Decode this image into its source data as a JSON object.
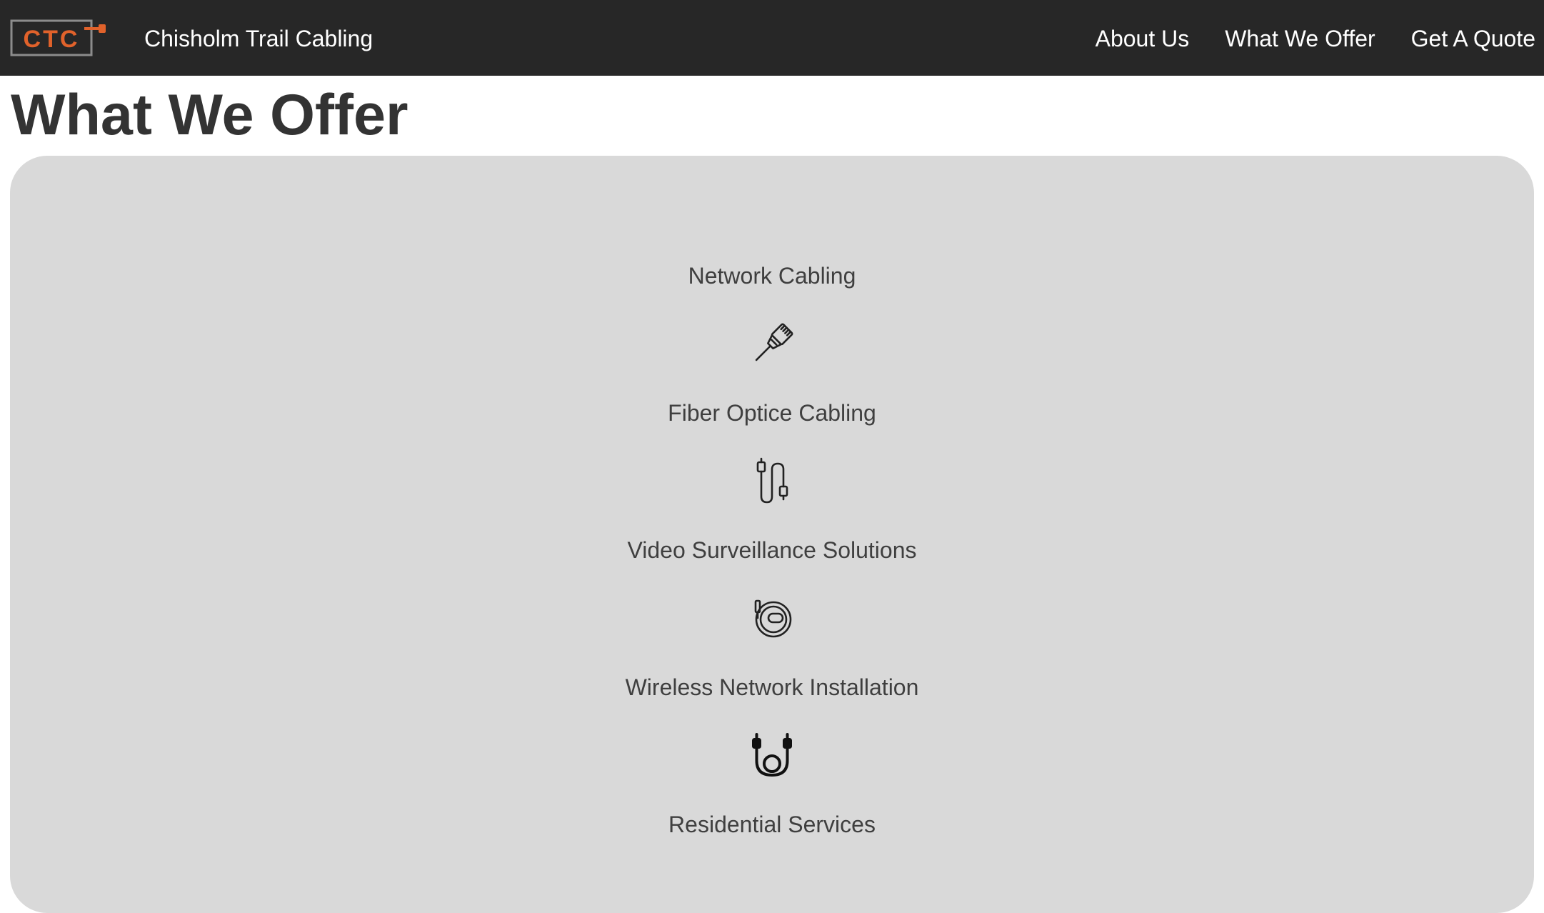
{
  "header": {
    "logo_text": "CTC",
    "brand": "Chisholm Trail Cabling",
    "nav": [
      {
        "label": "About Us"
      },
      {
        "label": "What We Offer"
      },
      {
        "label": "Get A Quote"
      }
    ]
  },
  "page": {
    "title": "What We Offer"
  },
  "services": [
    {
      "label": "Network Cabling",
      "icon": "ethernet-plug-icon"
    },
    {
      "label": "Fiber Optice Cabling",
      "icon": "usb-cable-icon"
    },
    {
      "label": "Video Surveillance Solutions",
      "icon": "coiled-cable-icon"
    },
    {
      "label": "Wireless Network Installation",
      "icon": "looped-connector-cable-icon"
    },
    {
      "label": "Residential Services"
    }
  ],
  "colors": {
    "nav_bg": "#272727",
    "card_bg": "#d9d9d9",
    "logo_accent": "#e1622b",
    "text": "#333333"
  }
}
